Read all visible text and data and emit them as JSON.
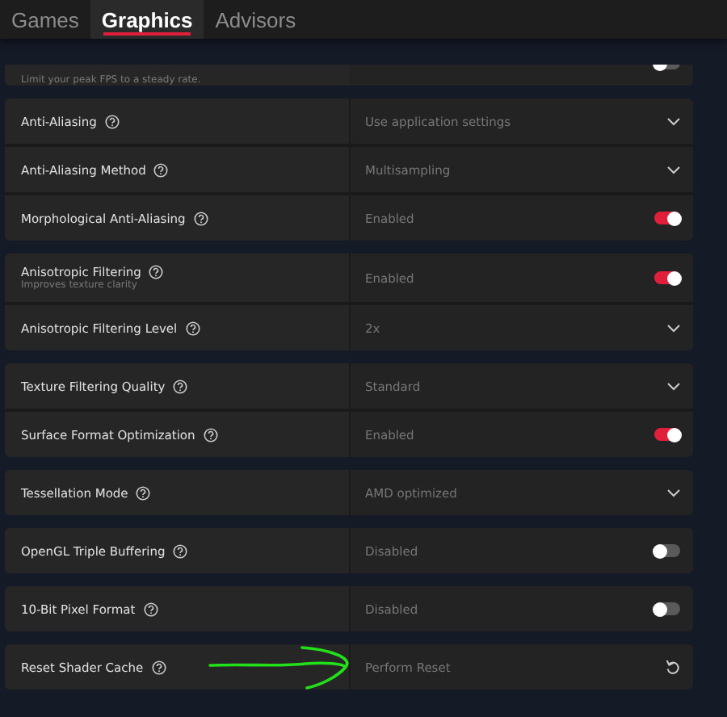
{
  "tabs": [
    {
      "label": "Games",
      "selected": false
    },
    {
      "label": "Graphics",
      "selected": true
    },
    {
      "label": "Advisors",
      "selected": false
    }
  ],
  "partial_card": {
    "description": "Limit your peak FPS to a steady rate.",
    "kind": "toggle",
    "on": false
  },
  "groups": [
    {
      "rows": [
        {
          "label": "Anti-Aliasing",
          "value": "Use application settings",
          "kind": "dropdown"
        },
        {
          "label": "Anti-Aliasing Method",
          "value": "Multisampling",
          "kind": "dropdown"
        },
        {
          "label": "Morphological Anti-Aliasing",
          "value": "Enabled",
          "kind": "toggle",
          "on": true
        }
      ]
    },
    {
      "rows": [
        {
          "label": "Anisotropic Filtering",
          "description": "Improves texture clarity",
          "value": "Enabled",
          "kind": "toggle",
          "on": true
        },
        {
          "label": "Anisotropic Filtering Level",
          "value": "2x",
          "kind": "dropdown"
        }
      ]
    },
    {
      "rows": [
        {
          "label": "Texture Filtering Quality",
          "value": "Standard",
          "kind": "dropdown"
        },
        {
          "label": "Surface Format Optimization",
          "value": "Enabled",
          "kind": "toggle",
          "on": true
        }
      ]
    },
    {
      "rows": [
        {
          "label": "Tessellation Mode",
          "value": "AMD optimized",
          "kind": "dropdown"
        }
      ]
    },
    {
      "rows": [
        {
          "label": "OpenGL Triple Buffering",
          "value": "Disabled",
          "kind": "toggle",
          "on": false
        }
      ]
    },
    {
      "rows": [
        {
          "label": "10-Bit Pixel Format",
          "value": "Disabled",
          "kind": "toggle",
          "on": false
        }
      ]
    },
    {
      "rows": [
        {
          "label": "Reset Shader Cache",
          "value": "Perform Reset",
          "kind": "action",
          "annotated": true
        }
      ]
    }
  ]
}
